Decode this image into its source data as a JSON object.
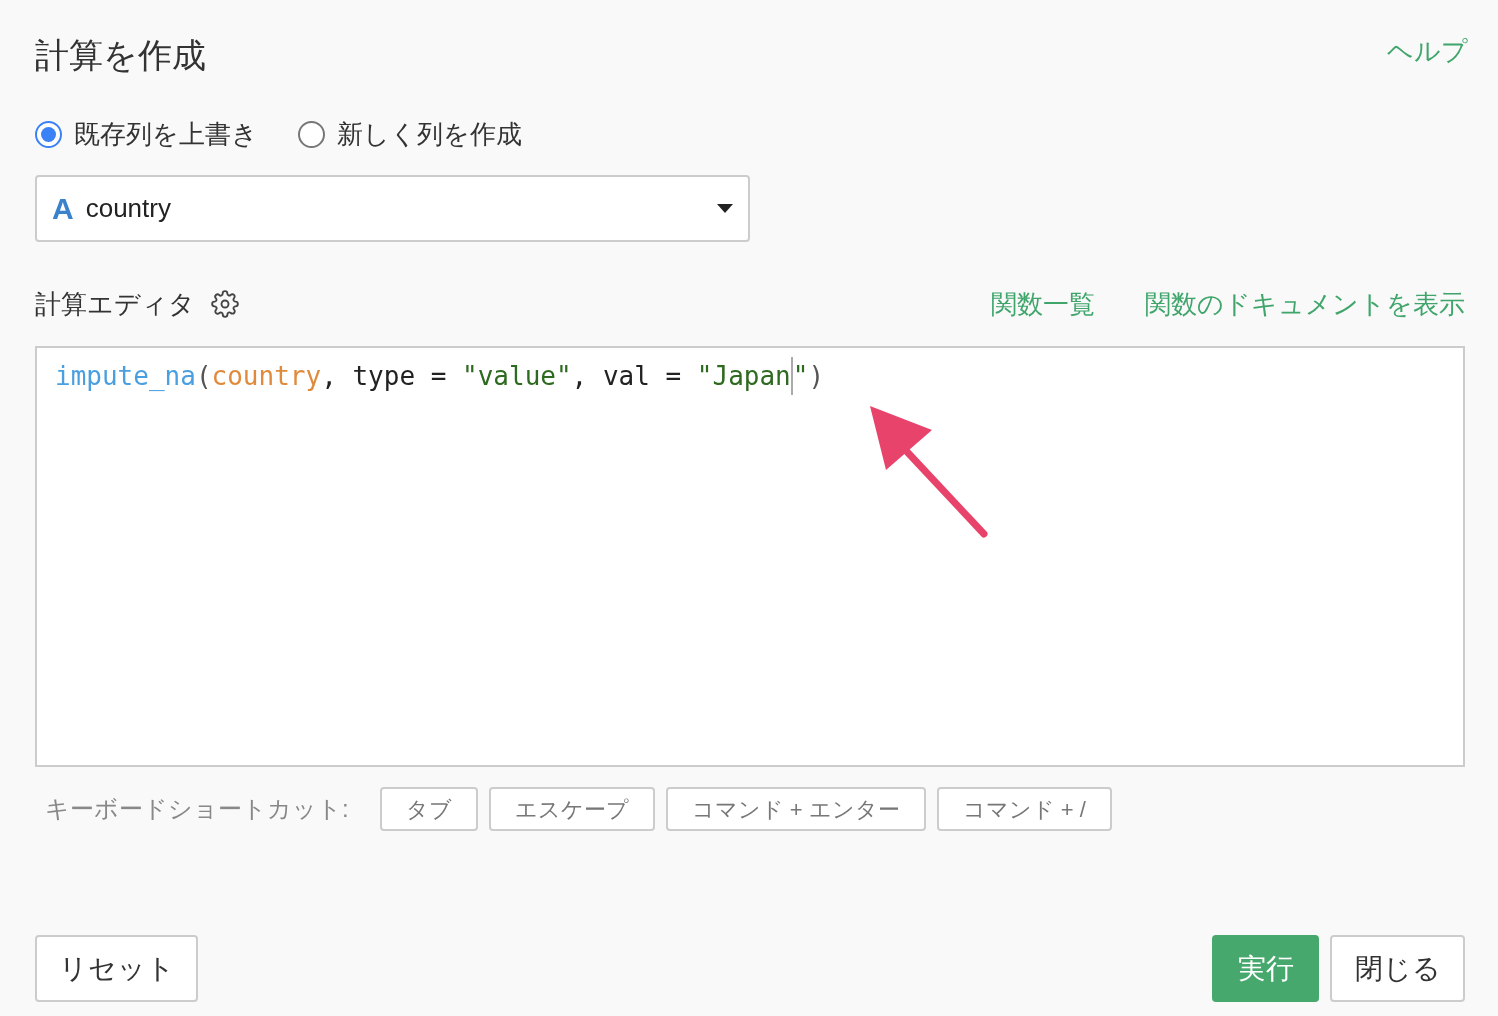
{
  "title": "計算を作成",
  "help_link": "ヘルプ",
  "modes": [
    {
      "label": "既存列を上書き",
      "selected": true
    },
    {
      "label": "新しく列を作成",
      "selected": false
    }
  ],
  "column_select": {
    "type_icon": "A",
    "value": "country"
  },
  "editor": {
    "label": "計算エディタ",
    "links": [
      "関数一覧",
      "関数のドキュメントを表示"
    ],
    "tokens": [
      {
        "text": "impute_na",
        "kind": "function"
      },
      {
        "text": "(",
        "kind": "punct"
      },
      {
        "text": "country",
        "kind": "column"
      },
      {
        "text": ", type = ",
        "kind": "plain"
      },
      {
        "text": "\"value\"",
        "kind": "string"
      },
      {
        "text": ", val = ",
        "kind": "plain"
      },
      {
        "text": "\"Japan",
        "kind": "string"
      },
      {
        "kind": "cursor"
      },
      {
        "text": "\"",
        "kind": "string"
      },
      {
        "text": ")",
        "kind": "punct"
      }
    ]
  },
  "shortcuts": {
    "label": "キーボードショートカット:",
    "keys": [
      "タブ",
      "エスケープ",
      "コマンド + エンター",
      "コマンド + /"
    ]
  },
  "buttons": {
    "reset": "リセット",
    "run": "実行",
    "close": "閉じる"
  }
}
